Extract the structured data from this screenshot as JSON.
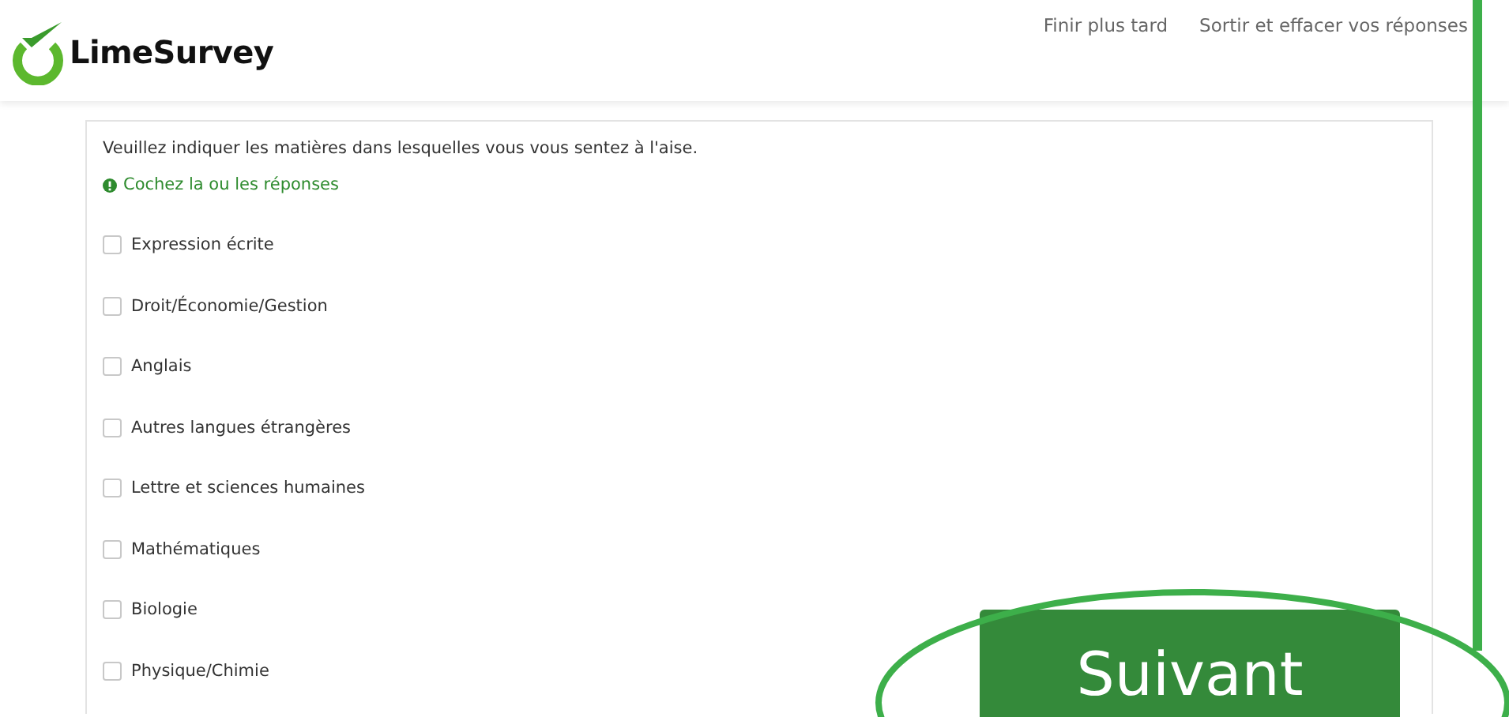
{
  "header": {
    "brand": "LimeSurvey",
    "links": [
      "Finir plus tard",
      "Sortir et effacer vos réponses"
    ]
  },
  "question": {
    "text": "Veuillez indiquer les matières dans lesquelles vous vous sentez à l'aise.",
    "hint": "Cochez la ou les réponses",
    "options": [
      {
        "label": "Expression écrite",
        "checked": false
      },
      {
        "label": "Droit/Économie/Gestion",
        "checked": false
      },
      {
        "label": "Anglais",
        "checked": false
      },
      {
        "label": "Autres langues étrangères",
        "checked": false
      },
      {
        "label": "Lettre et sciences humaines",
        "checked": false
      },
      {
        "label": "Mathématiques",
        "checked": false
      },
      {
        "label": "Biologie",
        "checked": false
      },
      {
        "label": "Physique/Chimie",
        "checked": false
      }
    ]
  },
  "next_button": {
    "label": "Suivant"
  }
}
